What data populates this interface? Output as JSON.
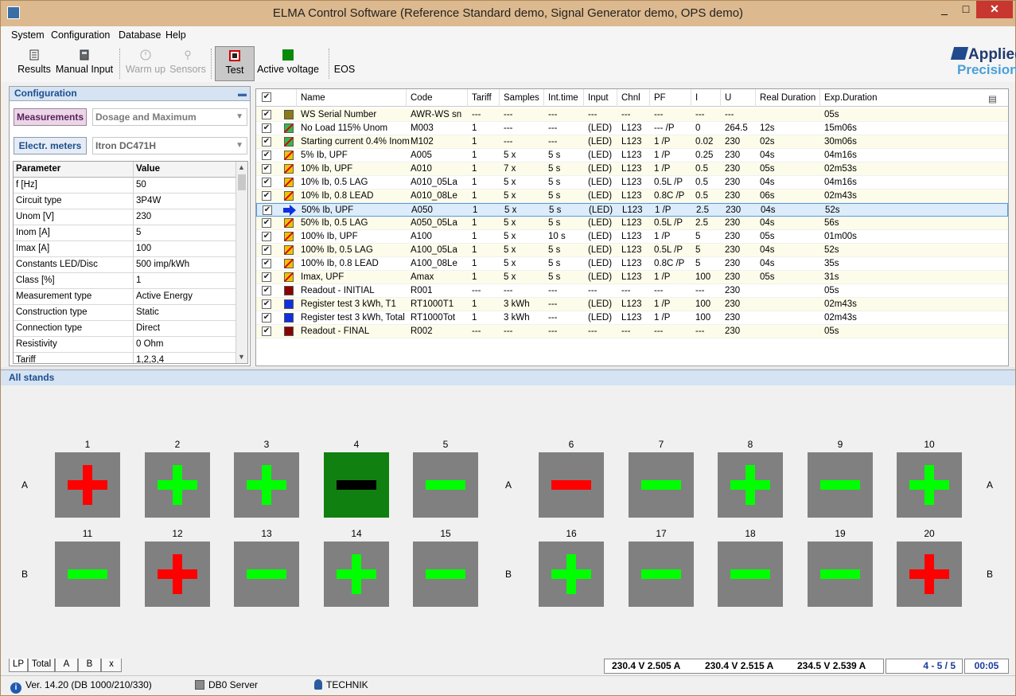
{
  "window": {
    "title": "ELMA Control Software (Reference Standard demo, Signal Generator demo, OPS demo)",
    "min": "_",
    "max": "□",
    "close": "✕"
  },
  "menu": [
    "System",
    "Configuration",
    "Database",
    "Help"
  ],
  "toolbar": {
    "results": "Results",
    "manual_input": "Manual Input",
    "warm_up": "Warm up",
    "sensors": "Sensors",
    "test": "Test",
    "active_voltage": "Active voltage",
    "eos": "EOS"
  },
  "logo": {
    "line1": "Applied",
    "line2": "Precision"
  },
  "config": {
    "title": "Configuration",
    "pin": "📌",
    "measurements_label": "Measurements",
    "measurements_value": "Dosage and Maximum",
    "meters_label": "Electr. meters",
    "meters_value": "Itron DC471H",
    "headers": {
      "param": "Parameter",
      "value": "Value"
    },
    "rows": [
      [
        "f [Hz]",
        "50"
      ],
      [
        "Circuit type",
        "3P4W"
      ],
      [
        "Unom [V]",
        "230"
      ],
      [
        "Inom [A]",
        "5"
      ],
      [
        "Imax [A]",
        "100"
      ],
      [
        "Constants LED/Disc",
        "500 imp/kWh"
      ],
      [
        "Class [%]",
        "1"
      ],
      [
        "Measurement type",
        "Active Energy"
      ],
      [
        "Construction type",
        "Static"
      ],
      [
        "Connection type",
        "Direct"
      ],
      [
        "Resistivity",
        "0 Ohm"
      ],
      [
        "Tariff",
        "1,2,3,4"
      ]
    ]
  },
  "grid": {
    "headers": [
      "Name",
      "Code",
      "Tariff",
      "Samples",
      "Int.time",
      "Input",
      "Chnl",
      "PF",
      "I",
      "U",
      "Real Duration",
      "Exp.Duration"
    ],
    "colors": {
      "olive": "#8a7a18",
      "nyan": "#39b54a",
      "yellow": "#f2c200",
      "dred": "#8b0000",
      "blue": "#1030e0"
    },
    "rows": [
      {
        "s": "olive",
        "c": [
          "WS Serial Number",
          "AWR-WS sn",
          "---",
          "---",
          "---",
          "---",
          "---",
          "---",
          "---",
          "---",
          "",
          "05s"
        ]
      },
      {
        "s": "green",
        "c": [
          "No Load 115% Unom",
          "M003",
          "1",
          "---",
          "---",
          "(LED)",
          "L123",
          "--- /P",
          "0",
          "264.5",
          "12s",
          "15m06s"
        ]
      },
      {
        "s": "green",
        "c": [
          "Starting current 0.4% Inom",
          "M102",
          "1",
          "---",
          "---",
          "(LED)",
          "L123",
          "1 /P",
          "0.02",
          "230",
          "02s",
          "30m06s"
        ]
      },
      {
        "s": "yellow",
        "c": [
          "5% Ib, UPF",
          "A005",
          "1",
          "5 x",
          "5 s",
          "(LED)",
          "L123",
          "1 /P",
          "0.25",
          "230",
          "04s",
          "04m16s"
        ]
      },
      {
        "s": "yellow",
        "c": [
          "10% Ib, UPF",
          "A010",
          "1",
          "7 x",
          "5 s",
          "(LED)",
          "L123",
          "1 /P",
          "0.5",
          "230",
          "05s",
          "02m53s"
        ]
      },
      {
        "s": "yellow",
        "c": [
          "10% Ib, 0.5 LAG",
          "A010_05La",
          "1",
          "5 x",
          "5 s",
          "(LED)",
          "L123",
          "0.5L /P",
          "0.5",
          "230",
          "04s",
          "04m16s"
        ]
      },
      {
        "s": "yellow",
        "c": [
          "10% Ib, 0.8 LEAD",
          "A010_08Le",
          "1",
          "5 x",
          "5 s",
          "(LED)",
          "L123",
          "0.8C /P",
          "0.5",
          "230",
          "06s",
          "02m43s"
        ]
      },
      {
        "s": "arrow",
        "c": [
          "50% Ib, UPF",
          "A050",
          "1",
          "5 x",
          "5 s",
          "(LED)",
          "L123",
          "1 /P",
          "2.5",
          "230",
          "04s",
          "52s"
        ]
      },
      {
        "s": "yellow",
        "c": [
          "50% Ib, 0.5 LAG",
          "A050_05La",
          "1",
          "5 x",
          "5 s",
          "(LED)",
          "L123",
          "0.5L /P",
          "2.5",
          "230",
          "04s",
          "56s"
        ]
      },
      {
        "s": "yellow",
        "c": [
          "100% Ib, UPF",
          "A100",
          "1",
          "5 x",
          "10 s",
          "(LED)",
          "L123",
          "1 /P",
          "5",
          "230",
          "05s",
          "01m00s"
        ]
      },
      {
        "s": "yellow",
        "c": [
          "100% Ib, 0.5 LAG",
          "A100_05La",
          "1",
          "5 x",
          "5 s",
          "(LED)",
          "L123",
          "0.5L /P",
          "5",
          "230",
          "04s",
          "52s"
        ]
      },
      {
        "s": "yellow",
        "c": [
          "100% Ib, 0.8 LEAD",
          "A100_08Le",
          "1",
          "5 x",
          "5 s",
          "(LED)",
          "L123",
          "0.8C /P",
          "5",
          "230",
          "04s",
          "35s"
        ]
      },
      {
        "s": "yellow",
        "c": [
          "Imax, UPF",
          "Amax",
          "1",
          "5 x",
          "5 s",
          "(LED)",
          "L123",
          "1 /P",
          "100",
          "230",
          "05s",
          "31s"
        ]
      },
      {
        "s": "dred",
        "c": [
          "Readout - INITIAL",
          "R001",
          "---",
          "---",
          "---",
          "---",
          "---",
          "---",
          "---",
          "230",
          "",
          "05s"
        ]
      },
      {
        "s": "blue",
        "c": [
          "Register test 3 kWh, T1",
          "RT1000T1",
          "1",
          "3 kWh",
          "---",
          "(LED)",
          "L123",
          "1 /P",
          "100",
          "230",
          "",
          "02m43s"
        ]
      },
      {
        "s": "blue",
        "c": [
          "Register test 3 kWh, Total",
          "RT1000Tot",
          "1",
          "3 kWh",
          "---",
          "(LED)",
          "L123",
          "1 /P",
          "100",
          "230",
          "",
          "02m43s"
        ]
      },
      {
        "s": "dred",
        "c": [
          "Readout - FINAL",
          "R002",
          "---",
          "---",
          "---",
          "---",
          "---",
          "---",
          "---",
          "230",
          "",
          "05s"
        ]
      }
    ]
  },
  "stands": {
    "title": "All stands",
    "row_labels": [
      "A",
      "B"
    ],
    "units": [
      {
        "n": "1",
        "sign": "plus",
        "color": "red"
      },
      {
        "n": "2",
        "sign": "plus",
        "color": "green"
      },
      {
        "n": "3",
        "sign": "plus",
        "color": "green"
      },
      {
        "n": "4",
        "sign": "minus",
        "color": "black",
        "bg": "green"
      },
      {
        "n": "5",
        "sign": "minus",
        "color": "green"
      },
      {
        "n": "6",
        "sign": "minus",
        "color": "red"
      },
      {
        "n": "7",
        "sign": "minus",
        "color": "green"
      },
      {
        "n": "8",
        "sign": "plus",
        "color": "green"
      },
      {
        "n": "9",
        "sign": "minus",
        "color": "green"
      },
      {
        "n": "10",
        "sign": "plus",
        "color": "green"
      },
      {
        "n": "11",
        "sign": "minus",
        "color": "green"
      },
      {
        "n": "12",
        "sign": "plus",
        "color": "red"
      },
      {
        "n": "13",
        "sign": "minus",
        "color": "green"
      },
      {
        "n": "14",
        "sign": "plus",
        "color": "green"
      },
      {
        "n": "15",
        "sign": "minus",
        "color": "green"
      },
      {
        "n": "16",
        "sign": "plus",
        "color": "green"
      },
      {
        "n": "17",
        "sign": "minus",
        "color": "green"
      },
      {
        "n": "18",
        "sign": "minus",
        "color": "green"
      },
      {
        "n": "19",
        "sign": "minus",
        "color": "green"
      },
      {
        "n": "20",
        "sign": "plus",
        "color": "red"
      }
    ],
    "sign_colors": {
      "red": "#ff0000",
      "green": "#00ff00",
      "black": "#000000"
    }
  },
  "tabs": [
    "LP",
    "Total",
    "A",
    "B",
    "x"
  ],
  "readings": {
    "phase1": "230.4 V  2.505 A",
    "phase2": "230.4 V  2.515 A",
    "phase3": "234.5 V  2.539 A",
    "progress": "4 - 5 / 5",
    "time": "00:05"
  },
  "status": {
    "version": "Ver. 14.20 (DB 1000/210/330)",
    "server": "DB0 Server",
    "user": "TECHNIK"
  }
}
